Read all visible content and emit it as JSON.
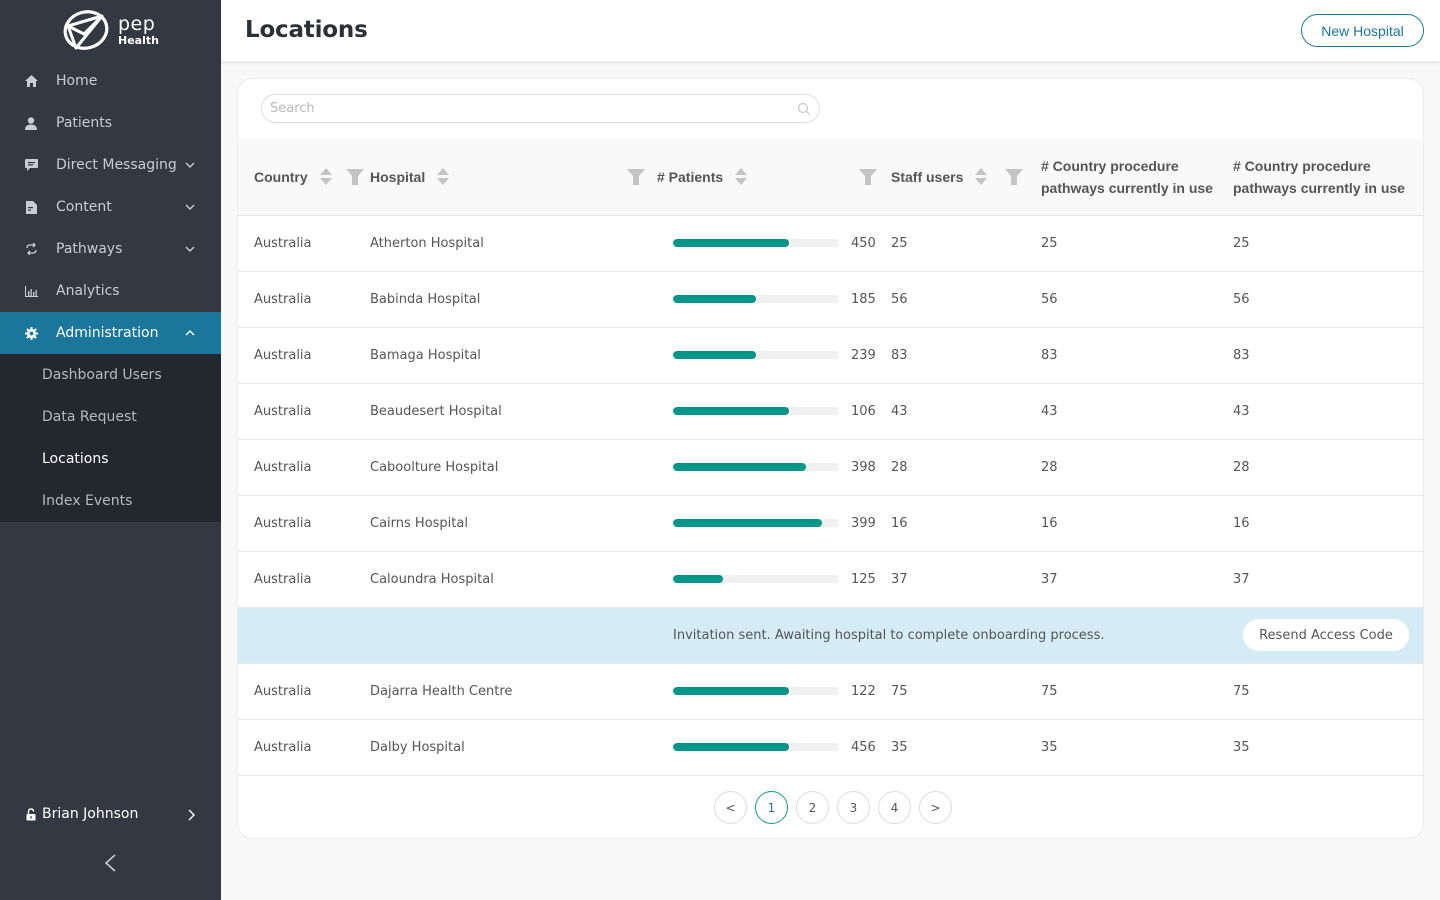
{
  "brand": {
    "name_top": "pep",
    "name_bottom": "Health"
  },
  "sidebar": {
    "items": [
      {
        "label": "Home",
        "icon": "home-icon",
        "has_chevron": false
      },
      {
        "label": "Patients",
        "icon": "user-icon",
        "has_chevron": false
      },
      {
        "label": "Direct Messaging",
        "icon": "message-icon",
        "has_chevron": true
      },
      {
        "label": "Content",
        "icon": "document-icon",
        "has_chevron": true
      },
      {
        "label": "Pathways",
        "icon": "sync-icon",
        "has_chevron": true
      },
      {
        "label": "Analytics",
        "icon": "bar-chart-icon",
        "has_chevron": false
      },
      {
        "label": "Administration",
        "icon": "gear-icon",
        "has_chevron": true,
        "active": true,
        "expanded": true
      }
    ],
    "subitems": [
      {
        "label": "Dashboard Users"
      },
      {
        "label": "Data Request"
      },
      {
        "label": "Locations",
        "current": true
      },
      {
        "label": "Index Events"
      }
    ],
    "user": {
      "name": "Brian Johnson"
    }
  },
  "header": {
    "title": "Locations",
    "new_button": "New Hospital"
  },
  "search": {
    "placeholder": "Search",
    "value": ""
  },
  "table": {
    "columns": [
      "Country",
      "Hospital",
      "# Patients",
      "Staff users",
      "# Country procedure pathways currently in use",
      "# Country procedure pathways currently in use"
    ],
    "rows": [
      {
        "country": "Australia",
        "hospital": "Atherton Hospital",
        "patients": 450,
        "patients_bar_pct": 70,
        "staff": 25,
        "pathways_a": 25,
        "pathways_b": 25
      },
      {
        "country": "Australia",
        "hospital": "Babinda Hospital",
        "patients": 185,
        "patients_bar_pct": 50,
        "staff": 56,
        "pathways_a": 56,
        "pathways_b": 56
      },
      {
        "country": "Australia",
        "hospital": "Bamaga Hospital",
        "patients": 239,
        "patients_bar_pct": 50,
        "staff": 83,
        "pathways_a": 83,
        "pathways_b": 83
      },
      {
        "country": "Australia",
        "hospital": "Beaudesert Hospital",
        "patients": 106,
        "patients_bar_pct": 70,
        "staff": 43,
        "pathways_a": 43,
        "pathways_b": 43
      },
      {
        "country": "Australia",
        "hospital": "Caboolture Hospital",
        "patients": 398,
        "patients_bar_pct": 80,
        "staff": 28,
        "pathways_a": 28,
        "pathways_b": 28
      },
      {
        "country": "Australia",
        "hospital": "Cairns Hospital",
        "patients": 399,
        "patients_bar_pct": 90,
        "staff": 16,
        "pathways_a": 16,
        "pathways_b": 16
      },
      {
        "country": "Australia",
        "hospital": "Caloundra Hospital",
        "patients": 125,
        "patients_bar_pct": 30,
        "staff": 37,
        "pathways_a": 37,
        "pathways_b": 37
      },
      {
        "type": "invitation",
        "message": "Invitation sent. Awaiting hospital to complete onboarding process.",
        "button": "Resend Access Code"
      },
      {
        "country": "Australia",
        "hospital": "Dajarra Health Centre",
        "patients": 122,
        "patients_bar_pct": 70,
        "staff": 75,
        "pathways_a": 75,
        "pathways_b": 75
      },
      {
        "country": "Australia",
        "hospital": "Dalby Hospital",
        "patients": 456,
        "patients_bar_pct": 70,
        "staff": 35,
        "pathways_a": 35,
        "pathways_b": 35
      }
    ]
  },
  "pagination": {
    "prev": "<",
    "next": ">",
    "pages": [
      "1",
      "2",
      "3",
      "4"
    ],
    "current": "1"
  },
  "colors": {
    "sidebar_bg": "#333842",
    "active_nav": "#1a769a",
    "bar_fill": "#009688",
    "invite_row": "#d5ebf6"
  }
}
